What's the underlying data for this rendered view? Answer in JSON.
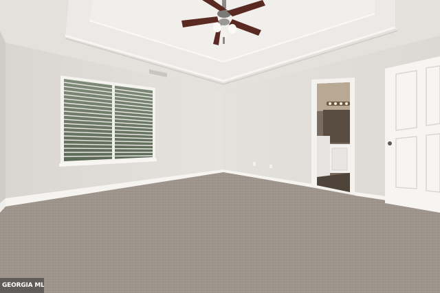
{
  "scene": {
    "description_type": "empty-bedroom-photo",
    "colors": {
      "wall": "#e2dfda",
      "ceiling": "#e9e7e3",
      "carpet": "#9f968d",
      "trim": "#f3f2ef",
      "fan_blade": "#5a2a22"
    },
    "icons": [
      "ceiling-fan-icon",
      "window-blinds-icon",
      "door-icon"
    ]
  },
  "watermark": {
    "text": "GEORGIA MLS"
  }
}
